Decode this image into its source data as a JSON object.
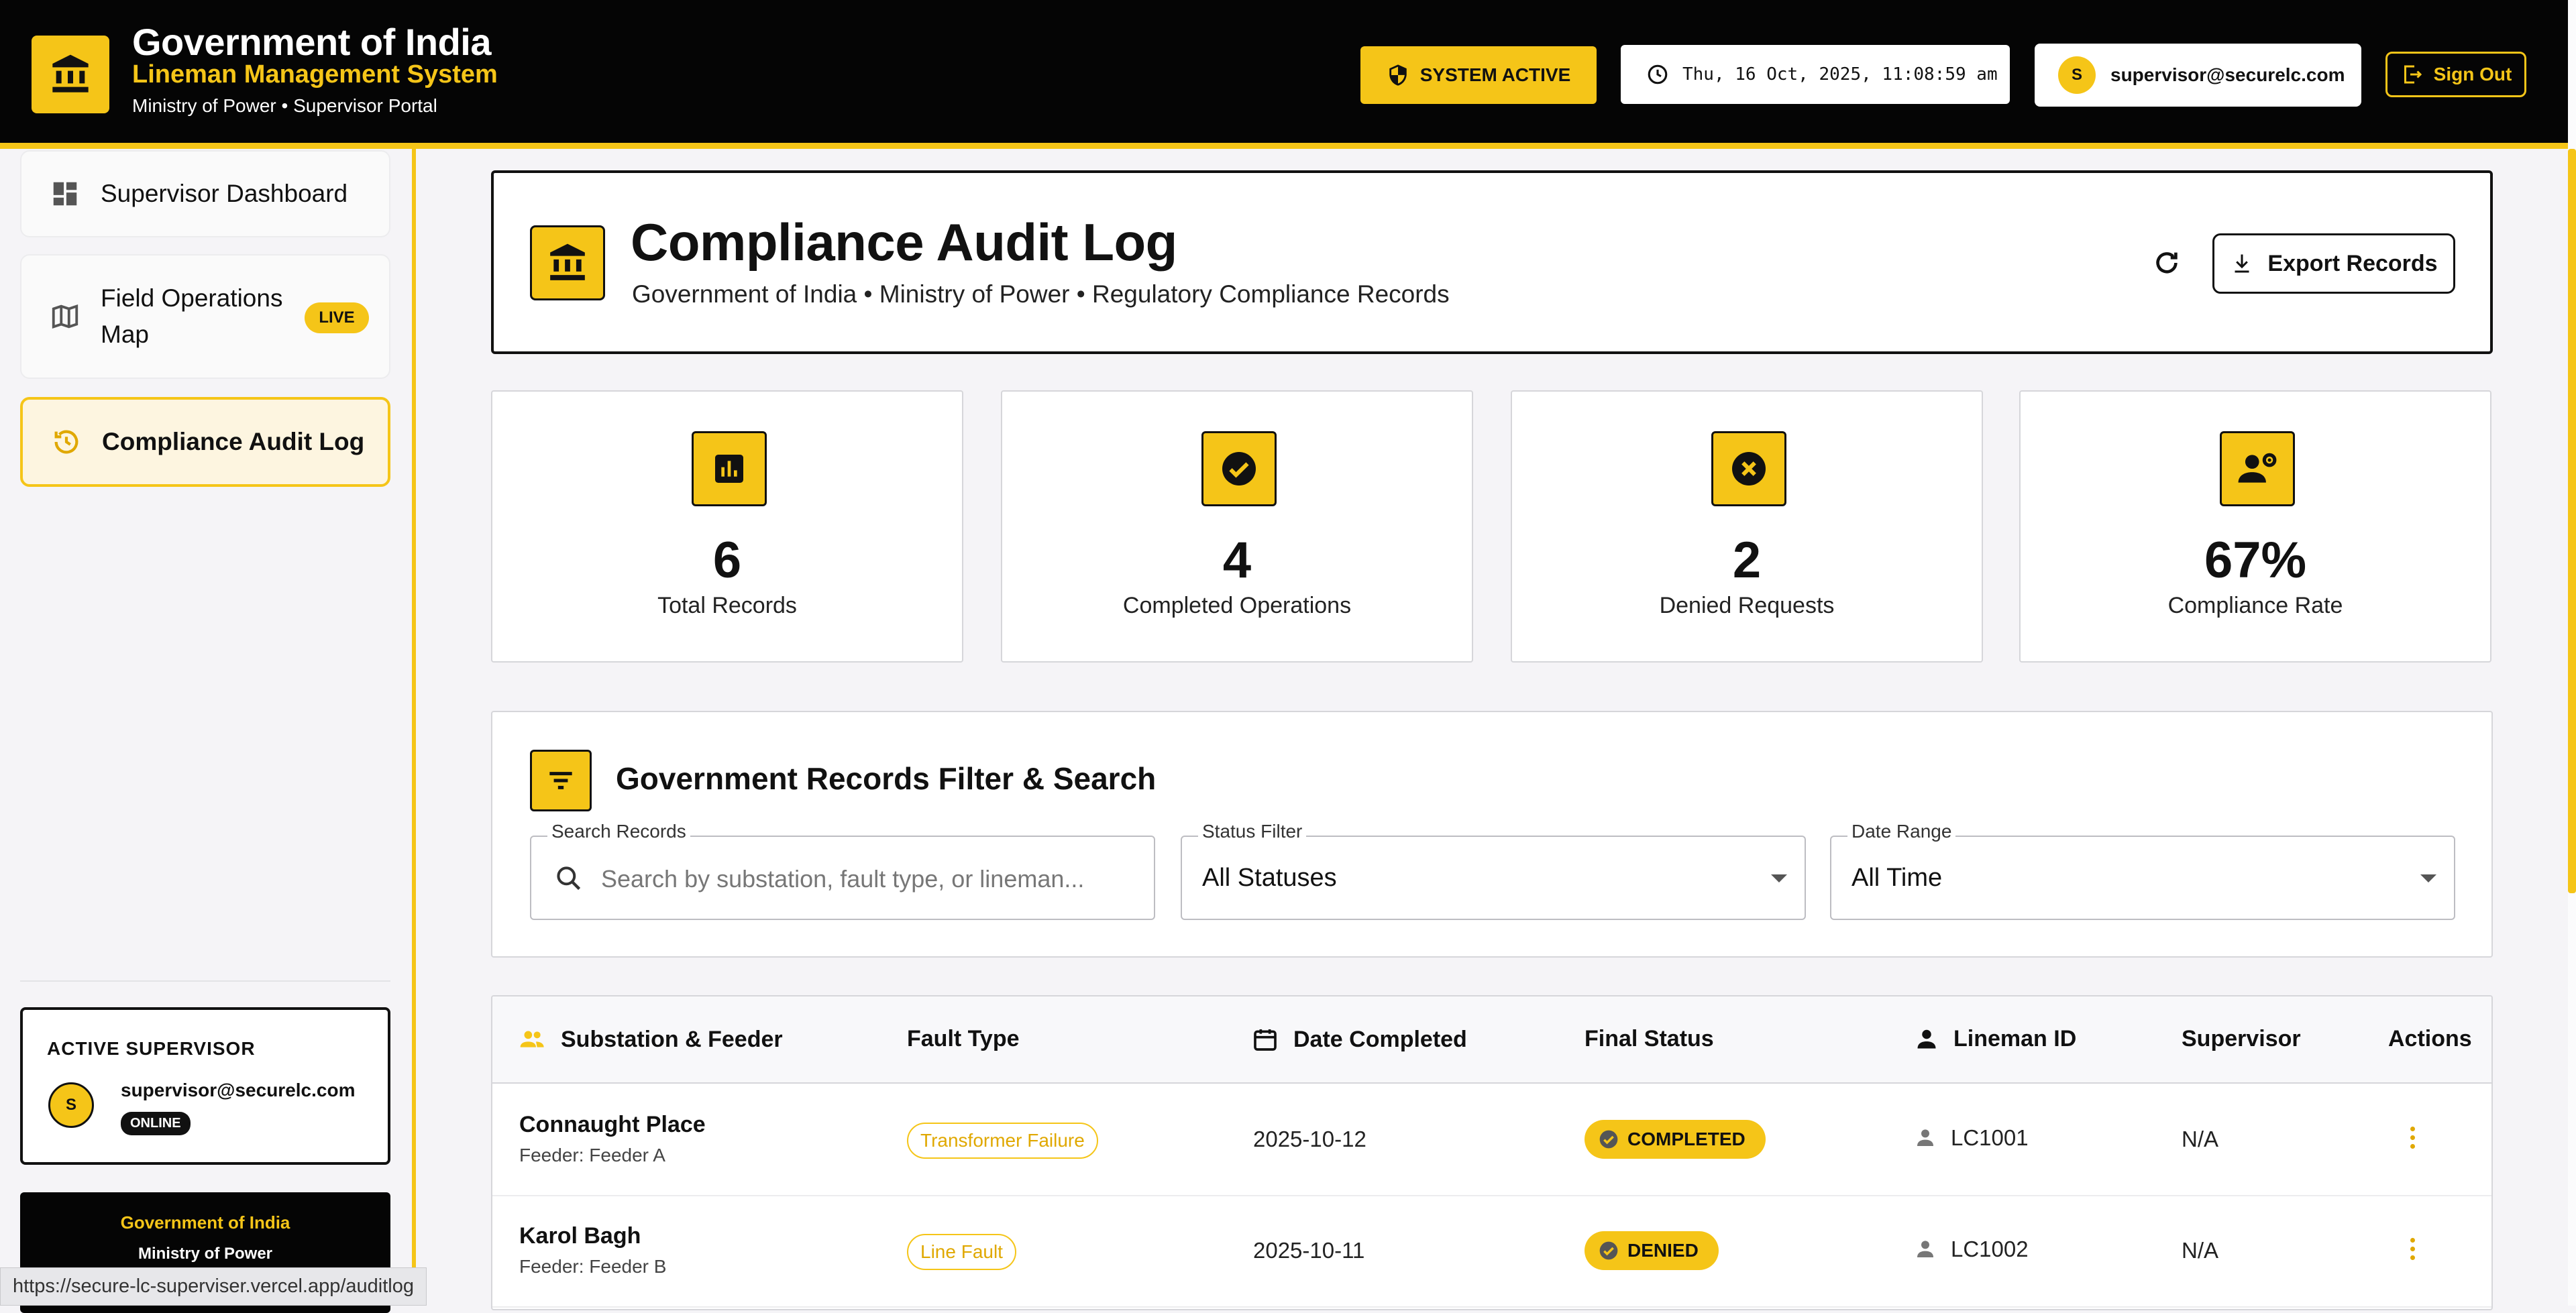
{
  "header": {
    "title": "Government of India",
    "subtitle": "Lineman Management System",
    "portal": "Ministry of Power • Supervisor Portal",
    "system_status": "SYSTEM ACTIVE",
    "datetime": "Thu, 16 Oct, 2025, 11:08:59 am",
    "user_initial": "S",
    "user_email": "supervisor@securelc.com",
    "signout_label": "Sign Out"
  },
  "sidebar": {
    "items": [
      {
        "label": "Supervisor Dashboard",
        "icon": "dashboard-icon"
      },
      {
        "label": "Field Operations Map",
        "icon": "map-icon",
        "badge": "LIVE"
      },
      {
        "label": "Compliance Audit Log",
        "icon": "history-icon",
        "active": true
      }
    ],
    "active_supervisor": {
      "title": "ACTIVE SUPERVISOR",
      "initial": "S",
      "email": "supervisor@securelc.com",
      "status": "ONLINE"
    },
    "footer": {
      "title": "Government of India",
      "subtitle": "Ministry of Power"
    }
  },
  "status_url": "https://secure-lc-superviser.vercel.app/auditlog",
  "page": {
    "title": "Compliance Audit Log",
    "subtitle": "Government of India • Ministry of Power • Regulatory Compliance Records",
    "export_label": "Export Records"
  },
  "stats": [
    {
      "value": "6",
      "label": "Total Records",
      "icon": "bar-chart-icon"
    },
    {
      "value": "4",
      "label": "Completed Operations",
      "icon": "check-circle-icon"
    },
    {
      "value": "2",
      "label": "Denied Requests",
      "icon": "cancel-circle-icon"
    },
    {
      "value": "67%",
      "label": "Compliance Rate",
      "icon": "engineer-icon"
    }
  ],
  "filters": {
    "heading": "Government Records Filter & Search",
    "search_label": "Search Records",
    "search_placeholder": "Search by substation, fault type, or lineman...",
    "status_label": "Status Filter",
    "status_value": "All Statuses",
    "date_label": "Date Range",
    "date_value": "All Time"
  },
  "table": {
    "columns": [
      "Substation & Feeder",
      "Fault Type",
      "Date Completed",
      "Final Status",
      "Lineman ID",
      "Supervisor",
      "Actions"
    ],
    "rows": [
      {
        "substation": "Connaught Place",
        "feeder": "Feeder: Feeder A",
        "fault": "Transformer Failure",
        "date": "2025-10-12",
        "status": "COMPLETED",
        "lineman": "LC1001",
        "supervisor": "N/A"
      },
      {
        "substation": "Karol Bagh",
        "feeder": "Feeder: Feeder B",
        "fault": "Line Fault",
        "date": "2025-10-11",
        "status": "DENIED",
        "lineman": "LC1002",
        "supervisor": "N/A"
      }
    ]
  },
  "colors": {
    "accent": "#f5c518",
    "header_bg": "#050505",
    "page_bg": "#f5f4f7"
  }
}
